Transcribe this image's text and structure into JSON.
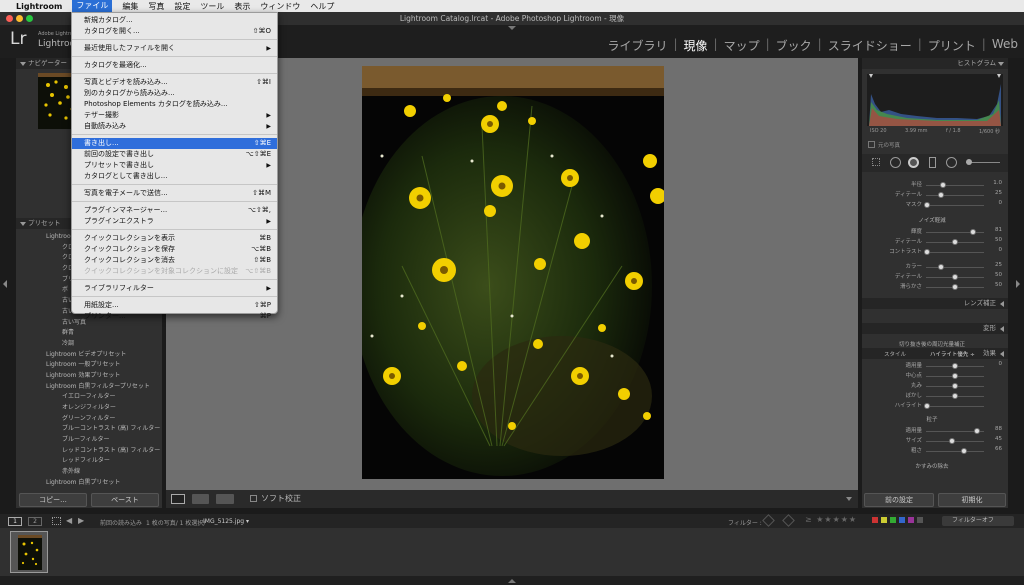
{
  "menubar": {
    "apple": "",
    "items": [
      "Lightroom",
      "ファイル",
      "編集",
      "写真",
      "設定",
      "ツール",
      "表示",
      "ウィンドウ",
      "ヘルプ"
    ]
  },
  "window": {
    "title": "Lightroom Catalog.lrcat - Adobe Photoshop Lightroom - 現像"
  },
  "brand": {
    "logo": "Lr",
    "vendor": "Adobe Lightroom",
    "product": "Lightroom"
  },
  "modules": [
    "ライブラリ",
    "現像",
    "マップ",
    "ブック",
    "スライドショー",
    "プリント",
    "Web"
  ],
  "module_separator": "|",
  "active_module_index": 1,
  "left_panel": {
    "navigator_label": "ナビゲーター",
    "presets_label": "プリセット",
    "preset_items": [
      "Lightroom",
      "クロ",
      "クロ",
      "クロ",
      "ブリ",
      "ボ",
      "古い",
      "古い",
      "古い写真",
      "群青",
      "冷調",
      "Lightroom ビデオプリセット",
      "Lightroom 一般プリセット",
      "Lightroom 効果プリセット",
      "Lightroom 白黒フィルタープリセット",
      "イエローフィルター",
      "オレンジフィルター",
      "グリーンフィルター",
      "ブルーコントラスト (高) フィルター",
      "ブルーフィルター",
      "レッドコントラスト (高) フィルター",
      "レッドフィルター",
      "赤外線",
      "Lightroom 白黒プリセット"
    ],
    "copy_button": "コピー...",
    "paste_button": "ペースト"
  },
  "file_menu": {
    "items": [
      {
        "label": "新規カタログ...",
        "shortcut": "",
        "sub": false,
        "disabled": false,
        "highlight": false
      },
      {
        "label": "カタログを開く...",
        "shortcut": "⇧⌘O",
        "sub": false,
        "disabled": false,
        "highlight": false
      },
      {
        "label": "最近使用したファイルを開く",
        "shortcut": "",
        "sub": true,
        "disabled": false,
        "highlight": false
      },
      {
        "label": "カタログを最適化...",
        "shortcut": "",
        "sub": false,
        "disabled": false,
        "highlight": false
      },
      {
        "label": "写真とビデオを読み込み...",
        "shortcut": "⇧⌘I",
        "sub": false,
        "disabled": false,
        "highlight": false
      },
      {
        "label": "別のカタログから読み込み...",
        "shortcut": "",
        "sub": false,
        "disabled": false,
        "highlight": false
      },
      {
        "label": "Photoshop Elements カタログを読み込み...",
        "shortcut": "",
        "sub": false,
        "disabled": false,
        "highlight": false
      },
      {
        "label": "テザー撮影",
        "shortcut": "",
        "sub": true,
        "disabled": false,
        "highlight": false
      },
      {
        "label": "自動読み込み",
        "shortcut": "",
        "sub": true,
        "disabled": false,
        "highlight": false
      },
      {
        "label": "書き出し...",
        "shortcut": "⇧⌘E",
        "sub": false,
        "disabled": false,
        "highlight": true
      },
      {
        "label": "前回の設定で書き出し",
        "shortcut": "⌥⇧⌘E",
        "sub": false,
        "disabled": false,
        "highlight": false
      },
      {
        "label": "プリセットで書き出し",
        "shortcut": "",
        "sub": true,
        "disabled": false,
        "highlight": false
      },
      {
        "label": "カタログとして書き出し...",
        "shortcut": "",
        "sub": false,
        "disabled": false,
        "highlight": false
      },
      {
        "label": "写真を電子メールで送信...",
        "shortcut": "⇧⌘M",
        "sub": false,
        "disabled": false,
        "highlight": false
      },
      {
        "label": "プラグインマネージャー...",
        "shortcut": "⌥⇧⌘,",
        "sub": false,
        "disabled": false,
        "highlight": false
      },
      {
        "label": "プラグインエクストラ",
        "shortcut": "",
        "sub": true,
        "disabled": false,
        "highlight": false
      },
      {
        "label": "クイックコレクションを表示",
        "shortcut": "⌘B",
        "sub": false,
        "disabled": false,
        "highlight": false
      },
      {
        "label": "クイックコレクションを保存",
        "shortcut": "⌥⌘B",
        "sub": false,
        "disabled": false,
        "highlight": false
      },
      {
        "label": "クイックコレクションを消去",
        "shortcut": "⇧⌘B",
        "sub": false,
        "disabled": false,
        "highlight": false
      },
      {
        "label": "クイックコレクションを対象コレクションに設定",
        "shortcut": "⌥⇧⌘B",
        "sub": false,
        "disabled": true,
        "highlight": false
      },
      {
        "label": "ライブラリフィルター",
        "shortcut": "",
        "sub": true,
        "disabled": false,
        "highlight": false
      },
      {
        "label": "用紙設定...",
        "shortcut": "⇧⌘P",
        "sub": false,
        "disabled": false,
        "highlight": false
      },
      {
        "label": "プリンター...",
        "shortcut": "⌘P",
        "sub": false,
        "disabled": false,
        "highlight": false
      }
    ]
  },
  "right_panel": {
    "histogram_label": "ヒストグラム",
    "exif": [
      "ISO 20",
      "3.99 mm",
      "f / 1.8",
      "1/600 秒"
    ],
    "original_photo": "元の写真",
    "detail_sliders": [
      {
        "label": "半径",
        "value": "1.0",
        "pos": 0.3
      },
      {
        "label": "ディテール",
        "value": "25",
        "pos": 0.25
      },
      {
        "label": "マスク",
        "value": "0",
        "pos": 0.02
      }
    ],
    "noise_label": "ノイズ軽減",
    "noise_lum": [
      {
        "label": "輝度",
        "value": "81",
        "pos": 0.81
      },
      {
        "label": "ディテール",
        "value": "50",
        "pos": 0.5
      },
      {
        "label": "コントラスト",
        "value": "0",
        "pos": 0.02
      }
    ],
    "noise_color": [
      {
        "label": "カラー",
        "value": "25",
        "pos": 0.25
      },
      {
        "label": "ディテール",
        "value": "50",
        "pos": 0.5
      },
      {
        "label": "滑らかさ",
        "value": "50",
        "pos": 0.5
      }
    ],
    "section_lens": "レンズ補正",
    "section_transform": "変形",
    "section_effects": "効果",
    "vignette_title": "切り抜き後の周辺光量補正",
    "style_label": "スタイル",
    "style_value": "ハイライト優先 ÷",
    "vignette_sliders": [
      {
        "label": "適用量",
        "value": "0",
        "pos": 0.5
      },
      {
        "label": "中心点",
        "value": "",
        "pos": 0.5
      },
      {
        "label": "丸み",
        "value": "",
        "pos": 0.5
      },
      {
        "label": "ぼかし",
        "value": "",
        "pos": 0.5
      },
      {
        "label": "ハイライト",
        "value": "",
        "pos": 0.02
      }
    ],
    "grain_label": "粒子",
    "grain_sliders": [
      {
        "label": "適用量",
        "value": "88",
        "pos": 0.88
      },
      {
        "label": "サイズ",
        "value": "45",
        "pos": 0.45
      },
      {
        "label": "粗さ",
        "value": "66",
        "pos": 0.66
      }
    ],
    "dehaze_label": "かすみの除去",
    "prev_button": "前の設定",
    "reset_button": "初期化"
  },
  "toolbar": {
    "softproof_label": "ソフト校正"
  },
  "filmstrip_bar": {
    "pages": [
      "1",
      "2"
    ],
    "source": "前回の読み込み",
    "count": "1 枚の写真/ 1 枚選択/",
    "filename": "IMG_5125.jpg ▾",
    "filter_label": "フィルター :",
    "filter_value": "フィルターオフ"
  },
  "colors": {
    "accent": "#2f6edb",
    "panel": "#303030",
    "center_bg": "#6f6f6f",
    "flower": "#f4d000"
  }
}
